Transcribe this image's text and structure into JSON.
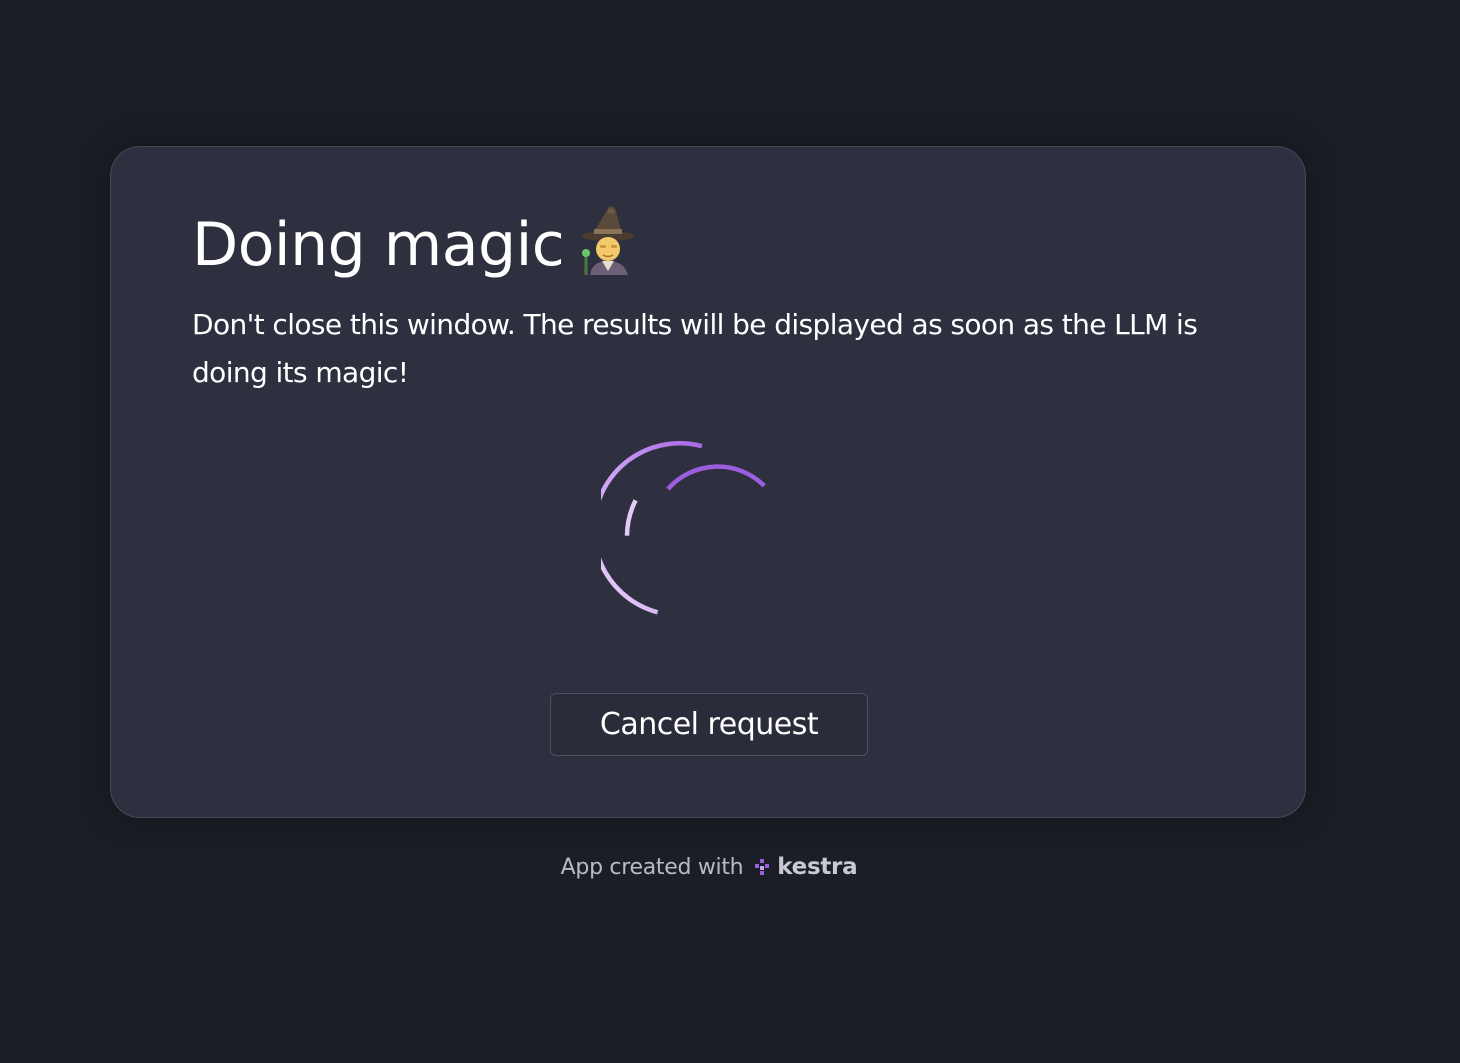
{
  "dialog": {
    "title": "Doing magic",
    "title_emoji_icon": "mage-icon",
    "description": "Don't close this window. The results will be displayed as soon as the LLM is doing its magic!",
    "cancel_label": "Cancel request"
  },
  "footer": {
    "prefix": "App created with",
    "brand": "kestra",
    "brand_icon": "kestra-logo-icon"
  },
  "colors": {
    "background": "#1c1e27",
    "card": "#2e3040",
    "spinner_outer": "#d4b0ef",
    "spinner_inner": "#9b5ee0",
    "text": "#ffffff"
  }
}
